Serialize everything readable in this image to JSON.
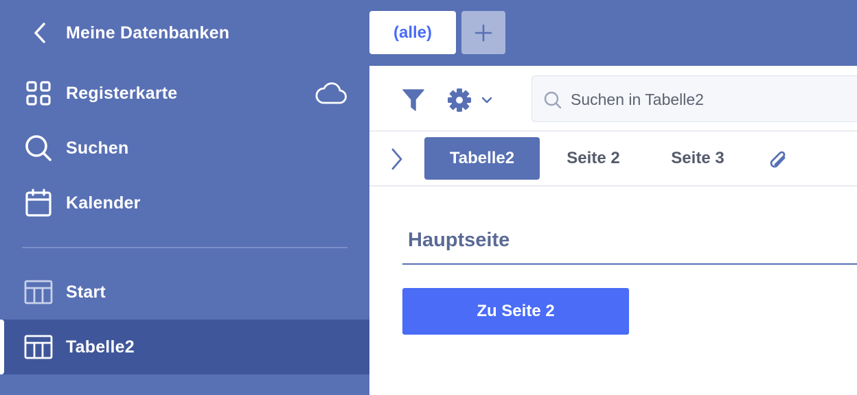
{
  "sidebar": {
    "back_label": "Meine Datenbanken",
    "items": [
      {
        "label": "Registerkarte",
        "icon": "grid-icon"
      },
      {
        "label": "Suchen",
        "icon": "search-icon"
      },
      {
        "label": "Kalender",
        "icon": "calendar-icon"
      }
    ],
    "tables": [
      {
        "label": "Start",
        "icon": "table-icon",
        "active": false
      },
      {
        "label": "Tabelle2",
        "icon": "table-icon",
        "active": true
      }
    ],
    "cloud_icon": "cloud-icon"
  },
  "topbar": {
    "tab_label": "(alle)",
    "add_icon": "plus-icon"
  },
  "toolbar": {
    "filter_icon": "filter-icon",
    "settings_icon": "gear-icon",
    "search_placeholder": "Suchen in Tabelle2"
  },
  "page_tabs": [
    {
      "label": "Tabelle2",
      "active": true
    },
    {
      "label": "Seite 2",
      "active": false
    },
    {
      "label": "Seite 3",
      "active": false
    }
  ],
  "content": {
    "heading": "Hauptseite",
    "button_label": "Zu Seite 2"
  },
  "colors": {
    "sidebar_bg": "#5870b4",
    "sidebar_active_bg": "#3f579a",
    "accent_button": "#4a6cf7"
  }
}
